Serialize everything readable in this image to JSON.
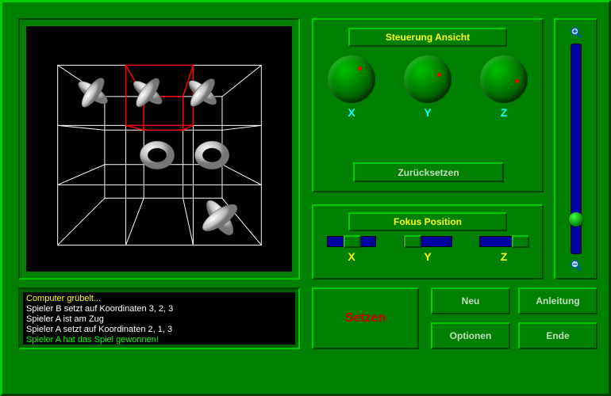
{
  "colors": {
    "panel_green": "#008000",
    "accent_yellow": "#ffff00",
    "accent_cyan": "#00ffff",
    "alert_red": "#cc0000"
  },
  "steuerung": {
    "title": "Steuerung Ansicht",
    "axes": [
      "X",
      "Y",
      "Z"
    ],
    "reset_label": "Zurücksetzen"
  },
  "fokus": {
    "title": "Fokus Position",
    "axes": [
      "X",
      "Y",
      "Z"
    ],
    "values": [
      2,
      1,
      3
    ],
    "max": 3
  },
  "zoom": {
    "value": 0.82,
    "icons": {
      "plus": "magnify-plus-icon",
      "minus": "magnify-minus-icon"
    }
  },
  "log": [
    {
      "text": "Computer grübelt...",
      "color": "#ffff00"
    },
    {
      "text": "Spieler B setzt auf Koordinaten 3, 2, 3",
      "color": "#ffffff"
    },
    {
      "text": "Spieler A ist am Zug",
      "color": "#ffffff"
    },
    {
      "text": "Spieler A setzt auf Koordinaten 2, 1, 3",
      "color": "#ffffff"
    },
    {
      "text": "Spieler A hat das Spiel gewonnen!",
      "color": "#00ff00"
    }
  ],
  "buttons": {
    "setzen": "Setzen",
    "neu": "Neu",
    "anleitung": "Anleitung",
    "optionen": "Optionen",
    "ende": "Ende"
  },
  "board": {
    "cursor_highlight": [
      1,
      0,
      2
    ],
    "pieces": [
      {
        "mark": "X",
        "pos": [
          0,
          0,
          2
        ]
      },
      {
        "mark": "X",
        "pos": [
          1,
          0,
          2
        ]
      },
      {
        "mark": "X",
        "pos": [
          2,
          0,
          2
        ]
      },
      {
        "mark": "O",
        "pos": [
          1,
          1,
          2
        ]
      },
      {
        "mark": "O",
        "pos": [
          2,
          1,
          2
        ]
      },
      {
        "mark": "X",
        "pos": [
          2,
          2,
          2
        ]
      }
    ]
  }
}
